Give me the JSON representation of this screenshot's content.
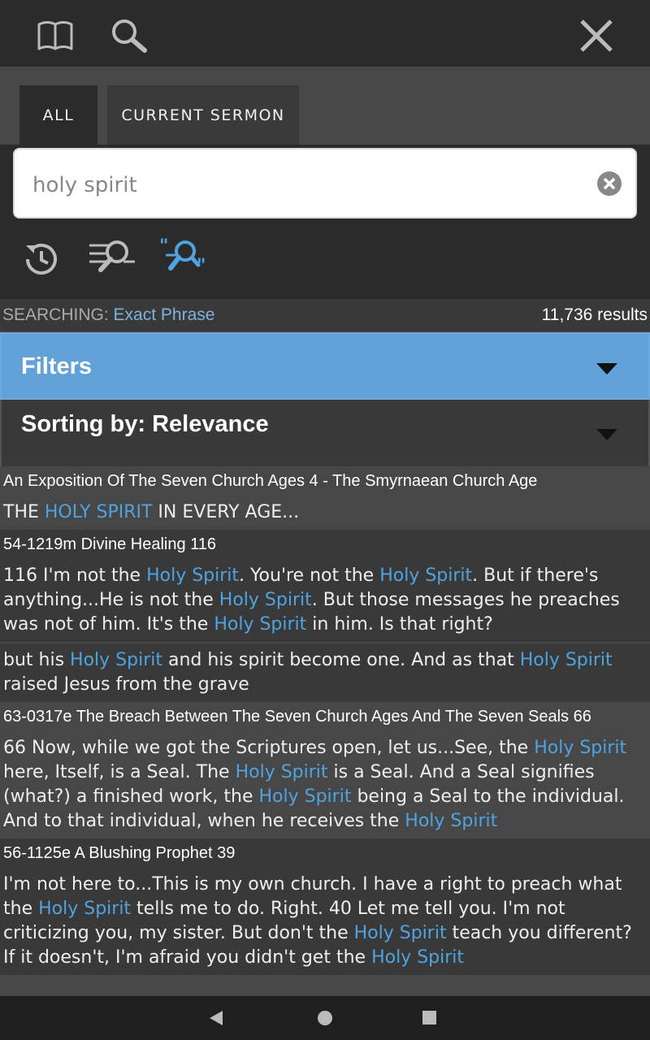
{
  "tabs": {
    "all": "ALL",
    "current": "CURRENT SERMON"
  },
  "search": {
    "value": "holy spirit"
  },
  "status": {
    "label": "SEARCHING: ",
    "mode": "Exact Phrase",
    "count": "11,736 results"
  },
  "filters": {
    "title": "Filters"
  },
  "sorting": {
    "title": "Sorting by: Relevance"
  },
  "results": [
    {
      "title": "An Exposition Of The Seven Church Ages 4 - The Smyrnaean Church Age",
      "snippets": [
        [
          {
            "t": "THE "
          },
          {
            "t": "HOLY SPIRIT",
            "h": true
          },
          {
            "t": " IN EVERY AGE..."
          }
        ]
      ]
    },
    {
      "title": "54-1219m Divine Healing 116",
      "snippets": [
        [
          {
            "t": "116 I'm not the "
          },
          {
            "t": "Holy Spirit",
            "h": true
          },
          {
            "t": ". You're not the "
          },
          {
            "t": "Holy Spirit",
            "h": true
          },
          {
            "t": ". But if there's anything...He is not the "
          },
          {
            "t": "Holy Spirit",
            "h": true
          },
          {
            "t": ". But those messages he preaches was not of him. It's the "
          },
          {
            "t": "Holy Spirit",
            "h": true
          },
          {
            "t": " in him. Is that right?"
          }
        ],
        [
          {
            "t": "but his "
          },
          {
            "t": "Holy Spirit",
            "h": true
          },
          {
            "t": " and his spirit become one. And as that "
          },
          {
            "t": "Holy Spirit",
            "h": true
          },
          {
            "t": " raised Jesus from the grave"
          }
        ]
      ]
    },
    {
      "title": "63-0317e The Breach Between The Seven Church Ages And The Seven Seals 66",
      "snippets": [
        [
          {
            "t": "66 Now, while we got the Scriptures open, let us...See, the "
          },
          {
            "t": "Holy Spirit",
            "h": true
          },
          {
            "t": " here, Itself, is a Seal. The "
          },
          {
            "t": "Holy Spirit",
            "h": true
          },
          {
            "t": " is a Seal. And a Seal signifies (what?) a finished work, the "
          },
          {
            "t": "Holy Spirit",
            "h": true
          },
          {
            "t": " being a Seal to the individual. And to that individual, when he receives the "
          },
          {
            "t": "Holy Spirit",
            "h": true
          }
        ]
      ]
    },
    {
      "title": "56-1125e A Blushing Prophet 39",
      "snippets": [
        [
          {
            "t": "I'm not here to...This is my own church. I have a right to preach what the "
          },
          {
            "t": "Holy Spirit",
            "h": true
          },
          {
            "t": " tells me to do. Right. 40 Let me tell you. I'm not criticizing you, my sister. But don't the "
          },
          {
            "t": "Holy Spirit",
            "h": true
          },
          {
            "t": " teach you different? If it doesn't, I'm afraid you didn't get the "
          },
          {
            "t": "Holy Spirit",
            "h": true
          }
        ]
      ]
    }
  ]
}
